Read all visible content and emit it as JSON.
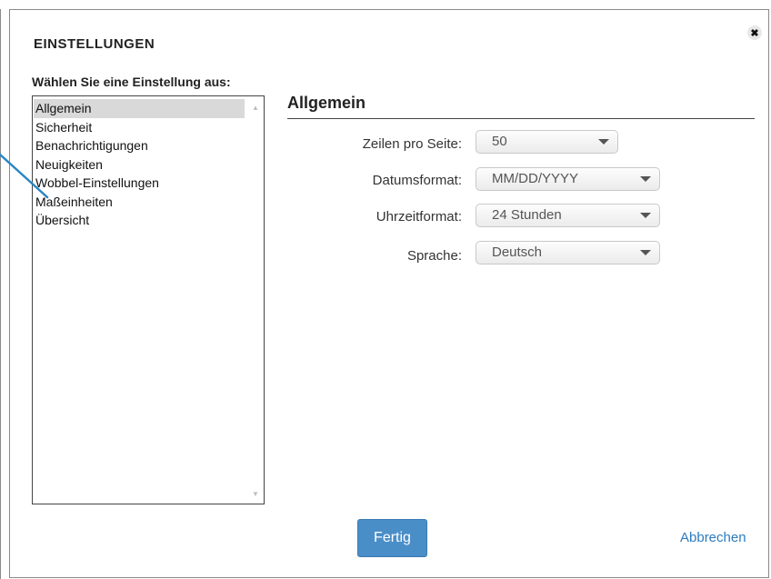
{
  "dialog": {
    "title": "EINSTELLUNGEN",
    "close_glyph": "✖",
    "close_icon": "close-icon"
  },
  "sidebar": {
    "prompt": "Wählen Sie eine Einstellung aus:",
    "selected_index": 0,
    "items": [
      {
        "label": "Allgemein"
      },
      {
        "label": "Sicherheit"
      },
      {
        "label": "Benachrichtigungen"
      },
      {
        "label": "Neuigkeiten"
      },
      {
        "label": "Wobbel-Einstellungen"
      },
      {
        "label": "Maßeinheiten"
      },
      {
        "label": "Übersicht"
      }
    ]
  },
  "main": {
    "section_title": "Allgemein",
    "fields": [
      {
        "label": "Zeilen pro Seite:",
        "value": "50"
      },
      {
        "label": "Datumsformat:",
        "value": "MM/DD/YYYY"
      },
      {
        "label": "Uhrzeitformat:",
        "value": "24 Stunden"
      },
      {
        "label": "Sprache:",
        "value": "Deutsch"
      }
    ]
  },
  "footer": {
    "primary_label": "Fertig",
    "secondary_label": "Abbrechen"
  },
  "colors": {
    "primary_button": "#4a8ec8",
    "link": "#2b7bbf",
    "callout_line": "#2a86c4",
    "selected_row": "#d9d9d9"
  }
}
